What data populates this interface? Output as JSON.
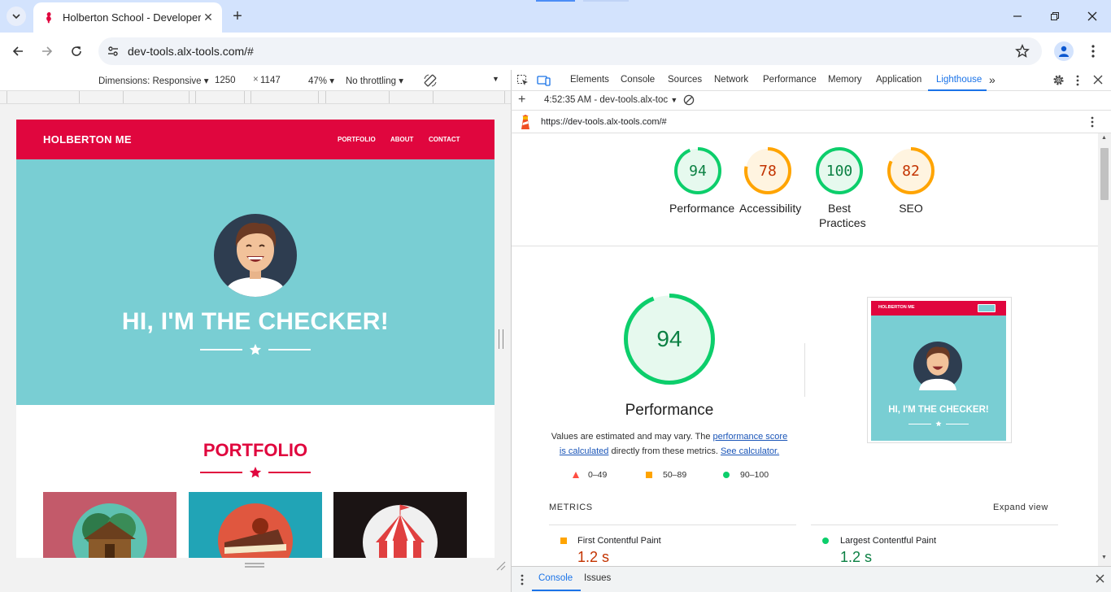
{
  "browser": {
    "tab_title": "Holberton School - Developer t",
    "url": "dev-tools.alx-tools.com/#"
  },
  "device_toolbar": {
    "dimensions_label": "Dimensions: Responsive",
    "width": "1250",
    "times": "×",
    "height": "1147",
    "zoom": "47%",
    "throttling": "No throttling"
  },
  "site": {
    "brand": "HOLBERTON ME",
    "nav": [
      "PORTFOLIO",
      "ABOUT",
      "CONTACT"
    ],
    "hero_title": "HI, I'M THE CHECKER!",
    "section_title": "PORTFOLIO",
    "colors": {
      "primary": "#e0063e",
      "hero": "#79ced3"
    }
  },
  "devtools": {
    "tabs": [
      "Elements",
      "Console",
      "Sources",
      "Network",
      "Performance",
      "Memory",
      "Application",
      "Lighthouse"
    ],
    "active_tab": "Lighthouse",
    "report_select": "4:52:35 AM - dev-tools.alx-toc",
    "report_url": "https://dev-tools.alx-tools.com/#",
    "drawer_tabs": [
      "Console",
      "Issues"
    ]
  },
  "lighthouse": {
    "scores": [
      {
        "label": "Performance",
        "value": "94",
        "status": "pass"
      },
      {
        "label": "Accessibility",
        "value": "78",
        "status": "average"
      },
      {
        "label": "Best Practices",
        "value": "100",
        "status": "pass"
      },
      {
        "label": "SEO",
        "value": "82",
        "status": "average"
      }
    ],
    "main_score": "94",
    "main_label": "Performance",
    "note_prefix": "Values are estimated and may vary. The ",
    "note_link1": "performance score is calculated",
    "note_mid": " directly from these metrics. ",
    "note_link2": "See calculator.",
    "legend": [
      "0–49",
      "50–89",
      "90–100"
    ],
    "screenshot": {
      "brand": "HOLBERTON ME",
      "title": "HI, I'M THE CHECKER!"
    },
    "metrics_title": "METRICS",
    "expand_label": "Expand view",
    "metrics": [
      {
        "label": "First Contentful Paint",
        "value": "1.2 s",
        "status": "average"
      },
      {
        "label": "Largest Contentful Paint",
        "value": "1.2 s",
        "status": "pass"
      }
    ],
    "colors": {
      "pass": "#0cce6b",
      "pass_text": "#0b8043",
      "average": "#ffa400",
      "average_text": "#c33300",
      "fail": "#ff4e42"
    }
  }
}
